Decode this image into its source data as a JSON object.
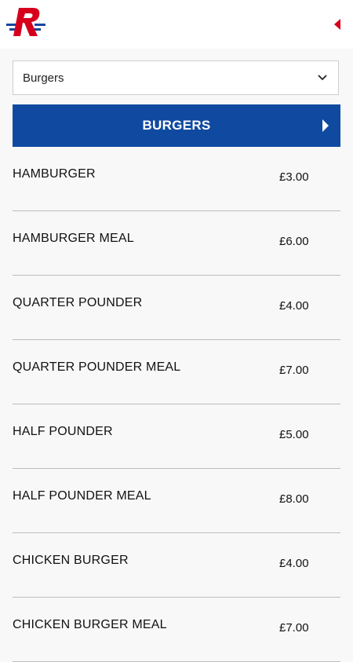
{
  "header": {
    "logo_icon": "r-logo-icon",
    "back_icon": "back-triangle-icon",
    "accent": "#d6001c"
  },
  "category_select": {
    "value": "Burgers",
    "icon": "chevron-down-icon"
  },
  "banner": {
    "title": "BURGERS",
    "icon": "arrow-right-icon",
    "color": "#0f4aa0"
  },
  "items": [
    {
      "name": "HAMBURGER",
      "price": "£3.00"
    },
    {
      "name": "HAMBURGER MEAL",
      "price": "£6.00"
    },
    {
      "name": "QUARTER POUNDER",
      "price": "£4.00"
    },
    {
      "name": "QUARTER POUNDER MEAL",
      "price": "£7.00"
    },
    {
      "name": "HALF POUNDER",
      "price": "£5.00"
    },
    {
      "name": "HALF POUNDER MEAL",
      "price": "£8.00"
    },
    {
      "name": "CHICKEN BURGER",
      "price": "£4.00"
    },
    {
      "name": "CHICKEN BURGER MEAL",
      "price": "£7.00"
    }
  ]
}
